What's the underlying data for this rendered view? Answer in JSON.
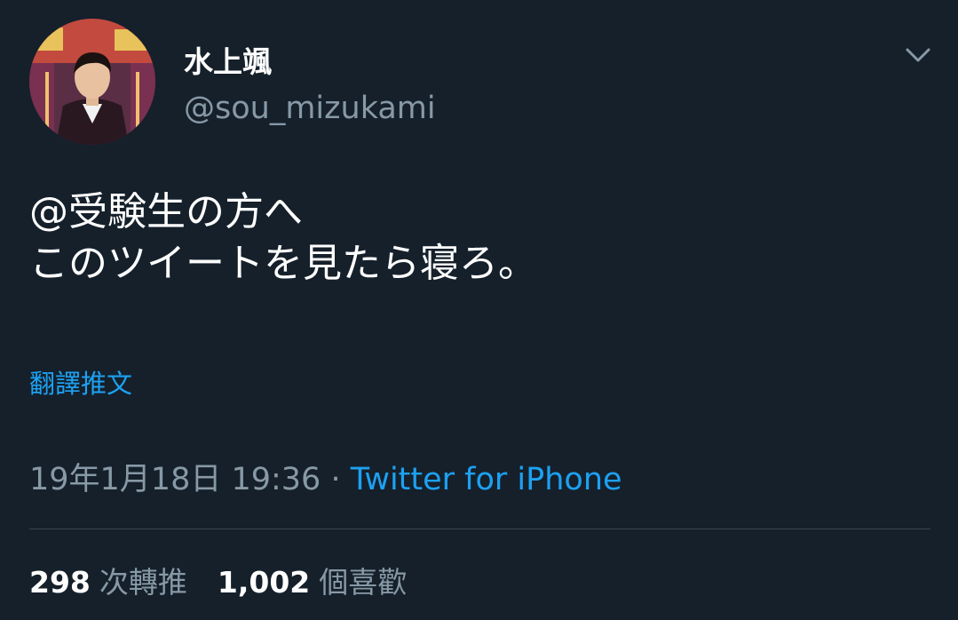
{
  "user": {
    "display_name": "水上颯",
    "handle": "@sou_mizukami",
    "avatar_icon": "profile-photo"
  },
  "tweet": {
    "lines": [
      "@受験生の方へ",
      "このツイートを見たら寝ろ。"
    ],
    "translate_label": "翻譯推文",
    "timestamp": "19年1月18日 19:36",
    "separator": " · ",
    "source": "Twitter for iPhone"
  },
  "stats": {
    "retweets_count": "298",
    "retweets_label": "次轉推",
    "likes_count": "1,002",
    "likes_label": "個喜歡"
  },
  "icons": {
    "menu": "chevron-down-icon"
  },
  "colors": {
    "background": "#15202b",
    "link": "#1da1f2",
    "secondary_text": "#8899a6",
    "divider": "#38444d"
  }
}
